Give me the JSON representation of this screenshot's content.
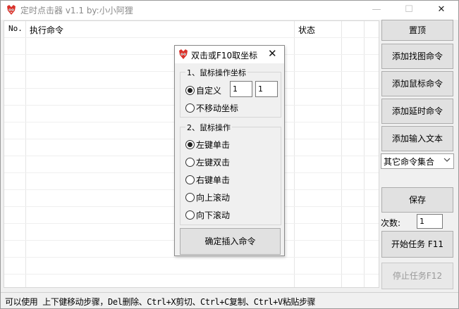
{
  "window": {
    "title": "定时点击器 v1.1 by:小小阿狸",
    "min_glyph": "—",
    "max_glyph": "☐",
    "close_glyph": "✕"
  },
  "table": {
    "columns": [
      "No.",
      "执行命令",
      "状态"
    ]
  },
  "sidebar": {
    "pin_label": "置顶",
    "add_find_image_label": "添加找图命令",
    "add_mouse_label": "添加鼠标命令",
    "add_delay_label": "添加延时命令",
    "add_input_text_label": "添加输入文本",
    "other_commands_selected": "其它命令集合",
    "save_label": "保存",
    "count_label": "次数:",
    "count_value": "1",
    "start_label": "开始任务 F11",
    "stop_label": "停止任务F12"
  },
  "status_bar": {
    "text": "可以使用 上下健移动步骤，Del删除、Ctrl+X剪切、Ctrl+C复制、Ctrl+V粘贴步骤"
  },
  "dialog": {
    "title": "双击或F10取坐标",
    "close_glyph": "✕",
    "group1_legend": "1、鼠标操作坐标",
    "custom_label": "自定义",
    "x_value": "1",
    "y_value": "1",
    "no_move_label": "不移动坐标",
    "group2_legend": "2、鼠标操作",
    "left_click_label": "左键单击",
    "left_double_label": "左键双击",
    "right_click_label": "右键单击",
    "scroll_up_label": "向上滚动",
    "scroll_down_label": "向下滚动",
    "insert_label": "确定插入命令",
    "selected_coord_mode": "custom",
    "selected_mouse_action": "left-click"
  },
  "colors": {
    "window_bg": "#f0f0f0",
    "button_bg": "#e1e1e1",
    "button_border": "#adadad",
    "disabled_text": "#9a9a9a",
    "title_text": "#8a8a8a",
    "app_icon_red": "#d9322b"
  },
  "icons": {
    "app": "fox-icon",
    "dropdown": "chevron-down-icon"
  }
}
